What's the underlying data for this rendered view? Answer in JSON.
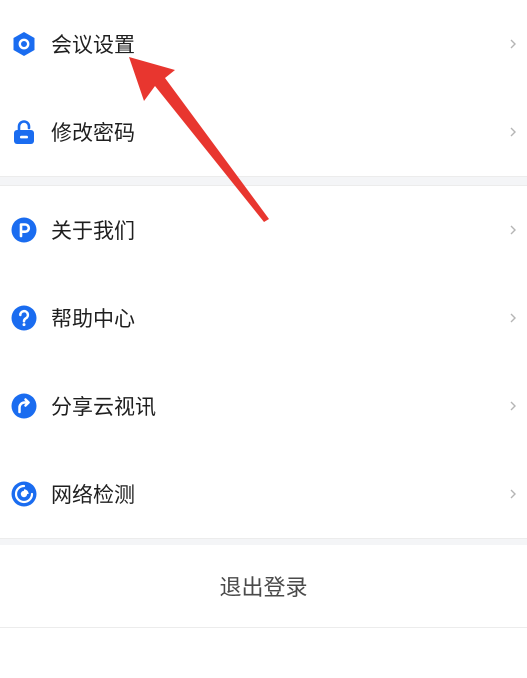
{
  "menu": {
    "items": [
      {
        "label": "会议设置",
        "icon": "hexagon-settings-icon"
      },
      {
        "label": "修改密码",
        "icon": "lock-icon"
      },
      {
        "label": "关于我们",
        "icon": "info-p-icon"
      },
      {
        "label": "帮助中心",
        "icon": "help-icon"
      },
      {
        "label": "分享云视讯",
        "icon": "share-icon"
      },
      {
        "label": "网络检测",
        "icon": "network-check-icon"
      }
    ],
    "chevron_icon": "chevron-right-icon"
  },
  "logout": {
    "label": "退出登录"
  },
  "annotation": {
    "icon": "red-arrow-annotation",
    "color": "#e8362f"
  },
  "colors": {
    "accent": "#1a6cf0",
    "label": "#1f1f1f",
    "separator": "#f4f5f7"
  }
}
